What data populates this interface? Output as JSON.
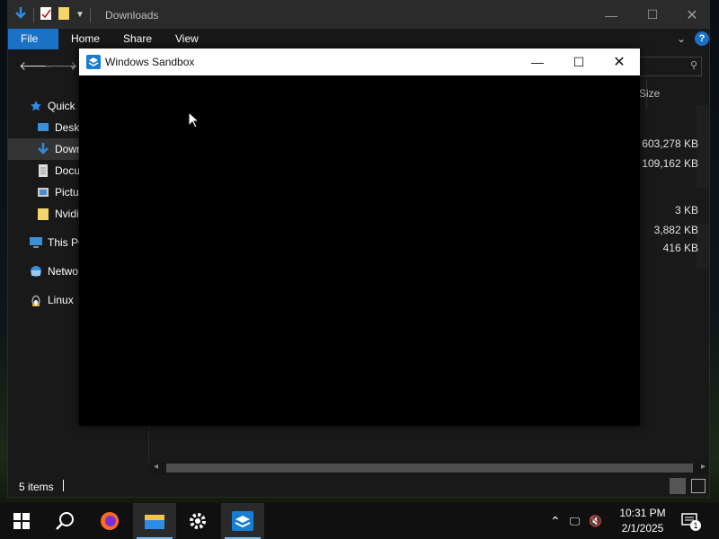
{
  "explorer": {
    "title": "Downloads",
    "ribbon_tabs": [
      "File",
      "Home",
      "Share",
      "View"
    ],
    "nav_items": [
      {
        "label": "Quick",
        "icon": "star-icon"
      },
      {
        "label": "Deskt",
        "icon": "desktop-icon"
      },
      {
        "label": "Down",
        "icon": "download-icon",
        "selected": true
      },
      {
        "label": "Docu",
        "icon": "document-icon"
      },
      {
        "label": "Pictu",
        "icon": "pictures-icon"
      },
      {
        "label": "Nvidi",
        "icon": "folder-icon"
      },
      {
        "label": "This PC",
        "icon": "computer-icon"
      },
      {
        "label": "Netwo",
        "icon": "network-icon"
      },
      {
        "label": "Linux",
        "icon": "linux-icon"
      }
    ],
    "column_header": "Size",
    "sizes": [
      "603,278 KB",
      "109,162 KB",
      "3 KB",
      "3,882 KB",
      "416 KB"
    ],
    "status": "5 items"
  },
  "sandbox": {
    "title": "Windows Sandbox"
  },
  "taskbar": {
    "time": "10:31 PM",
    "date": "2/1/2025",
    "notification_count": "1"
  },
  "colors": {
    "accent": "#1a72c4",
    "taskbar_underline": "#76b9ed"
  }
}
